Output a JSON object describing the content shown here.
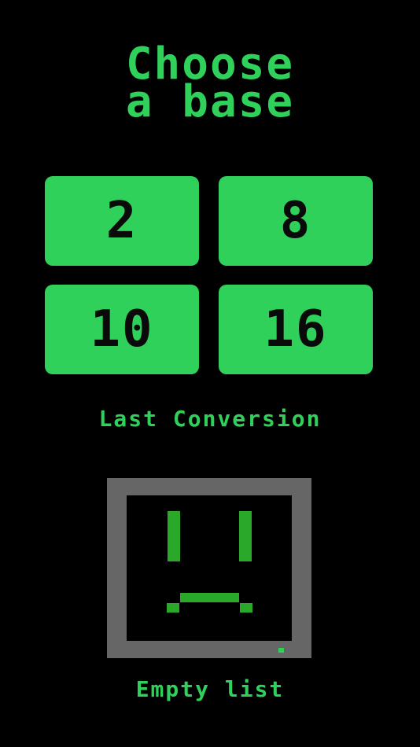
{
  "header": {
    "title_line1": "Choose",
    "title_line2": "a base"
  },
  "bases": [
    "2",
    "8",
    "10",
    "16"
  ],
  "history": {
    "label": "Last Conversion",
    "empty_text": "Empty list"
  },
  "colors": {
    "background": "#000000",
    "accent": "#2fd15a",
    "button_text": "#0a0a0a",
    "monitor_frame": "#666666",
    "face": "#2aa82a"
  },
  "icons": {
    "empty_state": "sad-monitor-icon"
  }
}
